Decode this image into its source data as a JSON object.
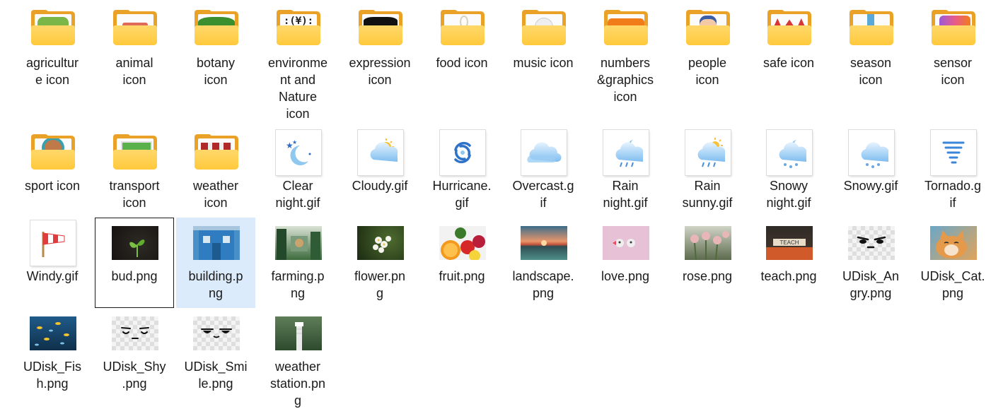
{
  "items": [
    {
      "label": "agricultur\ne icon",
      "icon": "folder-icon",
      "accent": "#7ab648"
    },
    {
      "label": "animal\nicon",
      "icon": "folder-icon",
      "accent": "#e06a5a"
    },
    {
      "label": "botany\nicon",
      "icon": "folder-icon",
      "accent": "#3b8f2f"
    },
    {
      "label": "environme\nnt and\nNature\nicon",
      "icon": "folder-icon",
      "accent": "#222222"
    },
    {
      "label": "expression\nicon",
      "icon": "folder-icon",
      "accent": "#111111"
    },
    {
      "label": "food icon",
      "icon": "folder-icon",
      "accent": "#d8d0b8"
    },
    {
      "label": "music icon",
      "icon": "folder-icon",
      "accent": "#eeeeee"
    },
    {
      "label": "numbers\n&graphics\nicon",
      "icon": "folder-icon",
      "accent": "#f07d1a"
    },
    {
      "label": "people\nicon",
      "icon": "folder-icon",
      "accent": "#f3c9a6"
    },
    {
      "label": "safe icon",
      "icon": "folder-icon",
      "accent": "#d93636"
    },
    {
      "label": "season\nicon",
      "icon": "folder-icon",
      "accent": "#5aa9d8"
    },
    {
      "label": "sensor\nicon",
      "icon": "folder-icon",
      "accent": "#9b59d8"
    },
    {
      "label": "sport icon",
      "icon": "folder-icon",
      "accent": "#3aa0b0"
    },
    {
      "label": "transport\nicon",
      "icon": "folder-icon",
      "accent": "#5ab04a"
    },
    {
      "label": "weather\nicon",
      "icon": "folder-icon",
      "accent": "#b02a2a"
    },
    {
      "label": "Clear\nnight.gif",
      "icon": "moon-stars-icon"
    },
    {
      "label": "Cloudy.gif",
      "icon": "cloud-sun-icon"
    },
    {
      "label": "Hurricane.\ngif",
      "icon": "hurricane-icon"
    },
    {
      "label": "Overcast.g\nif",
      "icon": "cloud-icon"
    },
    {
      "label": "Rain\nnight.gif",
      "icon": "rain-moon-icon"
    },
    {
      "label": "Rain\nsunny.gif",
      "icon": "rain-sun-icon"
    },
    {
      "label": "Snowy\nnight.gif",
      "icon": "snow-moon-icon"
    },
    {
      "label": "Snowy.gif",
      "icon": "snow-cloud-icon"
    },
    {
      "label": "Tornado.g\nif",
      "icon": "tornado-icon"
    },
    {
      "label": "Windy.gif",
      "icon": "windsock-icon"
    },
    {
      "label": "bud.png",
      "icon": "bud-photo",
      "focused": true
    },
    {
      "label": "building.p\nng",
      "icon": "building-photo",
      "selected": true
    },
    {
      "label": "farming.p\nng",
      "icon": "farming-photo"
    },
    {
      "label": "flower.pn\ng",
      "icon": "flower-photo"
    },
    {
      "label": "fruit.png",
      "icon": "fruit-photo"
    },
    {
      "label": "landscape.\npng",
      "icon": "landscape-photo"
    },
    {
      "label": "love.png",
      "icon": "love-photo"
    },
    {
      "label": "rose.png",
      "icon": "rose-photo"
    },
    {
      "label": "teach.png",
      "icon": "teach-photo",
      "photo_text": "TEACH"
    },
    {
      "label": "UDisk_An\ngry.png",
      "icon": "angry-face-photo"
    },
    {
      "label": "UDisk_Cat.\npng",
      "icon": "cat-photo"
    },
    {
      "label": "UDisk_Fis\nh.png",
      "icon": "fish-photo"
    },
    {
      "label": "UDisk_Shy\n.png",
      "icon": "shy-face-photo"
    },
    {
      "label": "UDisk_Smi\nle.png",
      "icon": "smile-face-photo"
    },
    {
      "label": "weather\nstation.pn\ng",
      "icon": "weather-station-photo"
    }
  ]
}
